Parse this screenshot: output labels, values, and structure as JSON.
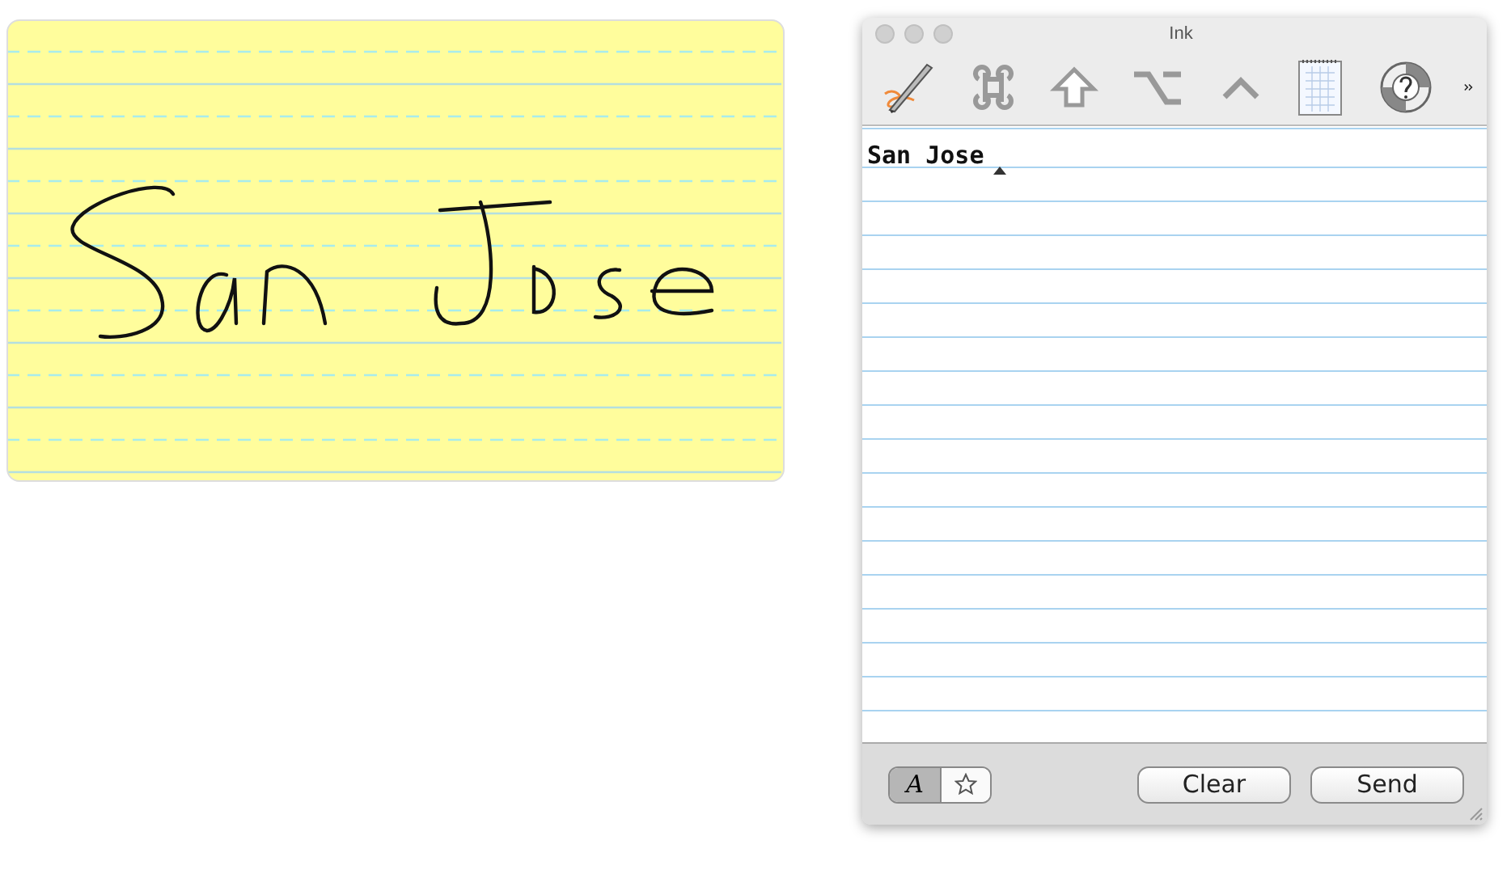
{
  "window": {
    "title": "Ink"
  },
  "toolbar": [
    {
      "kind": "pen",
      "selected": false
    },
    {
      "kind": "command",
      "selected": false
    },
    {
      "kind": "shift",
      "selected": false
    },
    {
      "kind": "option",
      "selected": false
    },
    {
      "kind": "control",
      "selected": false
    },
    {
      "kind": "notepad",
      "selected": false
    },
    {
      "kind": "help",
      "selected": false
    }
  ],
  "recognized_text": "San Jose",
  "mode_switch": [
    {
      "kind": "writing",
      "label": "A",
      "selected": true
    },
    {
      "kind": "star",
      "selected": false
    }
  ],
  "buttons": [
    "Clear",
    "Send"
  ]
}
